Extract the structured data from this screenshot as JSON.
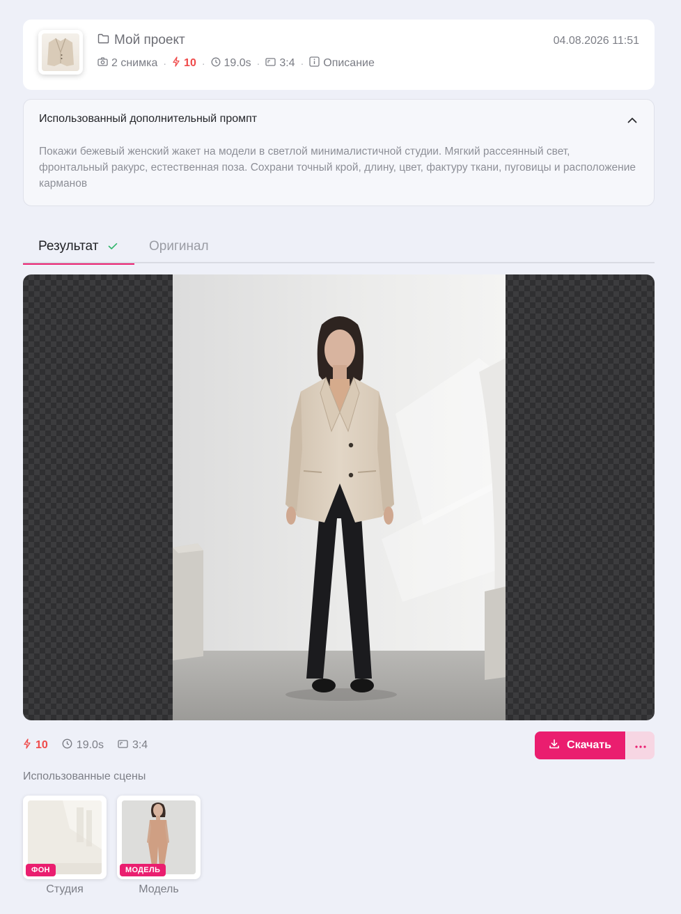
{
  "project": {
    "title": "Мой проект",
    "date": "04.08.2026 11:51",
    "shots": "2 снимка",
    "credits": "10",
    "duration": "19.0s",
    "ratio": "3:4",
    "description_label": "Описание"
  },
  "prompt": {
    "title": "Использованный дополнительный промпт",
    "text": "Покажи бежевый женский жакет на модели в светлой минималистичной студии. Мягкий рассеянный свет, фронтальный ракурс, естественная поза. Сохрани точный крой, длину, цвет, фактуру ткани, пуговицы и расположение карманов"
  },
  "tabs": {
    "result": "Результат",
    "original": "Оригинал"
  },
  "result": {
    "credits": "10",
    "duration": "19.0s",
    "ratio": "3:4",
    "download_label": "Скачать"
  },
  "scenes": {
    "title": "Использованные сцены",
    "items": [
      {
        "badge": "ФОН",
        "label": "Студия"
      },
      {
        "badge": "МОДЕЛЬ",
        "label": "Модель"
      }
    ]
  },
  "colors": {
    "accent": "#ea1e6f",
    "credits": "#ef4a4a",
    "success": "#2fb56a",
    "background": "#eef0f8"
  },
  "icons": {
    "folder": "folder-icon",
    "camera": "camera-icon",
    "bolt": "bolt-icon",
    "clock": "clock-icon",
    "ratio": "aspect-ratio-icon",
    "info": "info-icon",
    "chevron": "chevron-up-icon",
    "check": "check-icon",
    "download": "download-icon",
    "more": "more-icon"
  }
}
